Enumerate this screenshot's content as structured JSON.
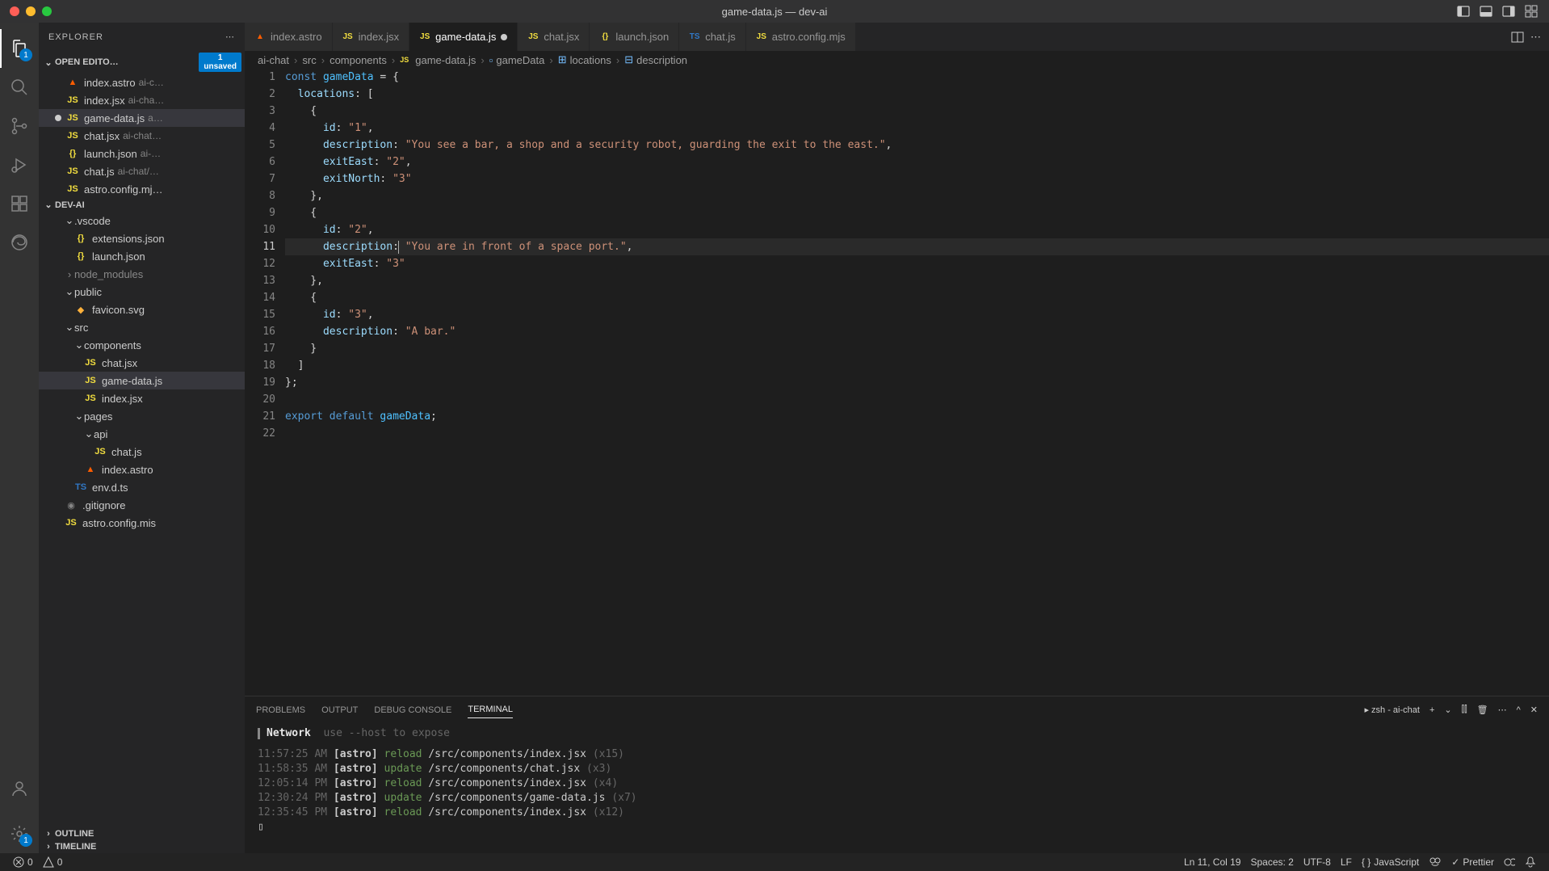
{
  "window": {
    "title": "game-data.js — dev-ai"
  },
  "activity": {
    "explorer_badge": "1",
    "settings_badge": "1"
  },
  "sidebar": {
    "title": "EXPLORER",
    "openEditors": {
      "label": "OPEN EDITO…",
      "unsaved_count": "1",
      "unsaved_label": "unsaved",
      "items": [
        {
          "name": "index.astro",
          "suffix": "ai-c…",
          "icon": "astro"
        },
        {
          "name": "index.jsx",
          "suffix": "ai-cha…",
          "icon": "js"
        },
        {
          "name": "game-data.js",
          "suffix": "a…",
          "icon": "js",
          "modified": true
        },
        {
          "name": "chat.jsx",
          "suffix": "ai-chat…",
          "icon": "js"
        },
        {
          "name": "launch.json",
          "suffix": "ai-…",
          "icon": "json"
        },
        {
          "name": "chat.js",
          "suffix": "ai-chat/…",
          "icon": "js"
        },
        {
          "name": "astro.config.mj…",
          "suffix": "",
          "icon": "js"
        }
      ]
    },
    "workspace": {
      "name": "DEV-AI",
      "tree": {
        "vscode": ".vscode",
        "extensions": "extensions.json",
        "launch": "launch.json",
        "node_modules": "node_modules",
        "public": "public",
        "favicon": "favicon.svg",
        "src": "src",
        "components": "components",
        "chatjsx": "chat.jsx",
        "gamedata": "game-data.js",
        "indexjsx": "index.jsx",
        "pages": "pages",
        "api": "api",
        "chatjs": "chat.js",
        "indexastro": "index.astro",
        "envdts": "env.d.ts",
        "gitignore": ".gitignore",
        "astroconfig": "astro.config.mis"
      }
    },
    "outline": "OUTLINE",
    "timeline": "TIMELINE"
  },
  "tabs": [
    {
      "name": "index.astro",
      "icon": "astro"
    },
    {
      "name": "index.jsx",
      "icon": "js"
    },
    {
      "name": "game-data.js",
      "icon": "js",
      "active": true,
      "dirty": true
    },
    {
      "name": "chat.jsx",
      "icon": "js"
    },
    {
      "name": "launch.json",
      "icon": "json"
    },
    {
      "name": "chat.js",
      "icon": "ts"
    },
    {
      "name": "astro.config.mjs",
      "icon": "js"
    }
  ],
  "breadcrumbs": [
    "ai-chat",
    "src",
    "components",
    "game-data.js",
    "gameData",
    "locations",
    "description"
  ],
  "code": {
    "lines": [
      "const gameData = {",
      "  locations: [",
      "    {",
      "      id: \"1\",",
      "      description: \"You see a bar, a shop and a security robot, guarding the exit to the east.\",",
      "      exitEast: \"2\",",
      "      exitNorth: \"3\"",
      "    },",
      "    {",
      "      id: \"2\",",
      "      description: \"You are in front of a space port.\",",
      "      exitEast: \"3\"",
      "    },",
      "    {",
      "      id: \"3\",",
      "      description: \"A bar.\"",
      "    }",
      "  ]",
      "};",
      "",
      "export default gameData;",
      ""
    ]
  },
  "panel": {
    "tabs": {
      "problems": "PROBLEMS",
      "output": "OUTPUT",
      "debug": "DEBUG CONSOLE",
      "terminal": "TERMINAL"
    },
    "terminal_name": "zsh - ai-chat",
    "network_label": "Network",
    "network_hint": "use --host to expose",
    "log": [
      {
        "time": "11:57:25 AM",
        "tag": "[astro]",
        "action": "reload",
        "path": "/src/components/index.jsx",
        "count": "(x15)"
      },
      {
        "time": "11:58:35 AM",
        "tag": "[astro]",
        "action": "update",
        "path": "/src/components/chat.jsx",
        "count": "(x3)"
      },
      {
        "time": "12:05:14 PM",
        "tag": "[astro]",
        "action": "reload",
        "path": "/src/components/index.jsx",
        "count": "(x4)"
      },
      {
        "time": "12:30:24 PM",
        "tag": "[astro]",
        "action": "update",
        "path": "/src/components/game-data.js",
        "count": "(x7)"
      },
      {
        "time": "12:35:45 PM",
        "tag": "[astro]",
        "action": "reload",
        "path": "/src/components/index.jsx",
        "count": "(x12)"
      }
    ]
  },
  "status": {
    "errors": "0",
    "warnings": "0",
    "cursor": "Ln 11, Col 19",
    "spaces": "Spaces: 2",
    "encoding": "UTF-8",
    "eol": "LF",
    "language": "JavaScript",
    "prettier": "Prettier"
  }
}
